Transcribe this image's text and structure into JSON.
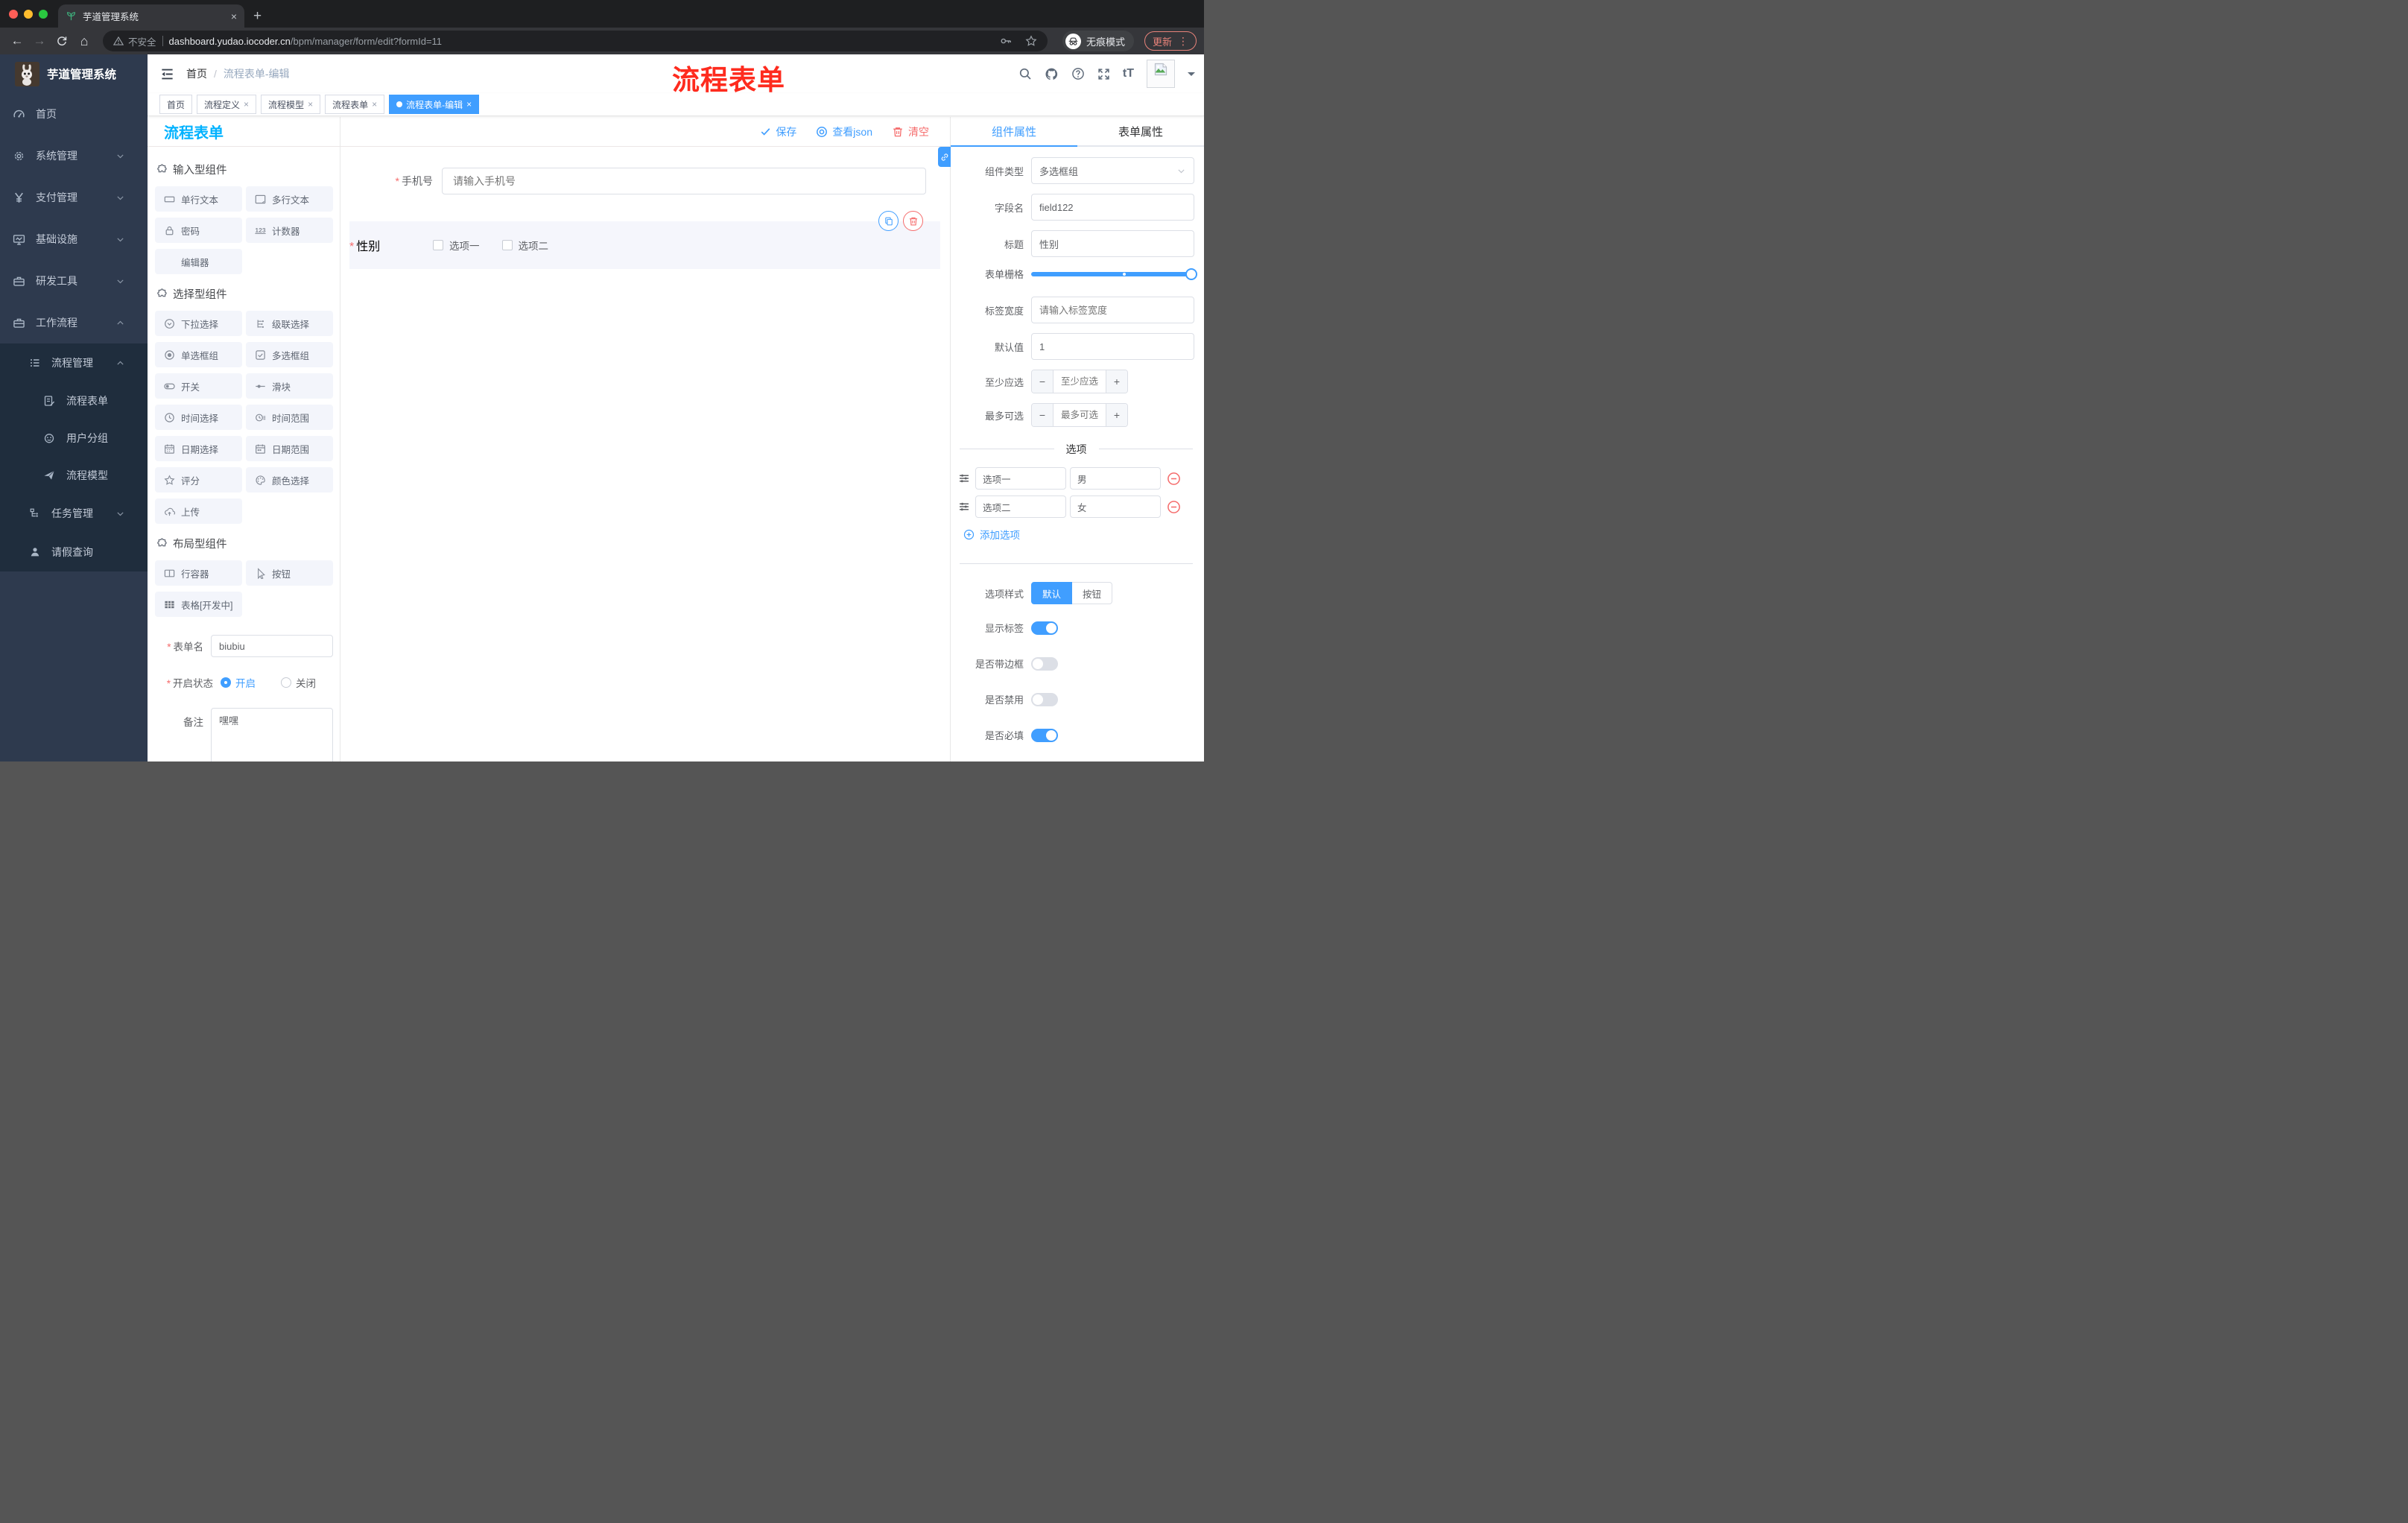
{
  "browser": {
    "tab_title": "芋道管理系统",
    "security": "不安全",
    "url_host": "dashboard.yudao.iocoder.cn",
    "url_path": "/bpm/manager/form/edit?formId=11",
    "incognito": "无痕模式",
    "update": "更新"
  },
  "sidebar": {
    "brand": "芋道管理系统",
    "home": "首页",
    "system": "系统管理",
    "pay": "支付管理",
    "infra": "基础设施",
    "dev": "研发工具",
    "workflow": "工作流程",
    "process_manage": "流程管理",
    "process_form": "流程表单",
    "user_group": "用户分组",
    "process_model": "流程模型",
    "task_manage": "任务管理",
    "leave_query": "请假查询"
  },
  "header": {
    "breadcrumb_home": "首页",
    "breadcrumb_sep": "/",
    "breadcrumb_current": "流程表单-编辑",
    "annotation": "流程表单"
  },
  "tags": {
    "home": "首页",
    "def": "流程定义",
    "model": "流程模型",
    "form": "流程表单",
    "edit": "流程表单-编辑"
  },
  "palette": {
    "title": "流程表单",
    "sec_input": "输入型组件",
    "single": "单行文本",
    "multi": "多行文本",
    "password": "密码",
    "counter": "计数器",
    "counter_glyph": "123",
    "editor": "编辑器",
    "sec_select": "选择型组件",
    "select": "下拉选择",
    "cascader": "级联选择",
    "radio": "单选框组",
    "checkbox": "多选框组",
    "switch": "开关",
    "slider": "滑块",
    "time": "时间选择",
    "time_range": "时间范围",
    "date": "日期选择",
    "date_range": "日期范围",
    "rate": "评分",
    "color": "颜色选择",
    "upload": "上传",
    "sec_layout": "布局型组件",
    "row": "行容器",
    "button": "按钮",
    "table": "表格[开发中]"
  },
  "meta": {
    "name_label": "表单名",
    "name_value": "biubiu",
    "status_label": "开启状态",
    "status_on": "开启",
    "status_off": "关闭",
    "remark_label": "备注",
    "remark_value": "嘿嘿"
  },
  "canvas": {
    "save": "保存",
    "view_json": "查看json",
    "clear": "清空",
    "phone_label": "手机号",
    "phone_placeholder": "请输入手机号",
    "gender_label": "性别",
    "opt1": "选项一",
    "opt2": "选项二"
  },
  "props": {
    "tab_component": "组件属性",
    "tab_form": "表单属性",
    "type_label": "组件类型",
    "type_value": "多选框组",
    "field_label": "字段名",
    "field_value": "field122",
    "title_label": "标题",
    "title_value": "性别",
    "grid_label": "表单栅格",
    "width_label": "标签宽度",
    "width_placeholder": "请输入标签宽度",
    "default_label": "默认值",
    "default_value": "1",
    "min_label": "至少应选",
    "min_placeholder": "至少应选",
    "max_label": "最多可选",
    "max_placeholder": "最多可选",
    "options_title": "选项",
    "opt1_label": "选项一",
    "opt1_value": "男",
    "opt2_label": "选项二",
    "opt2_value": "女",
    "add_option": "添加选项",
    "style_label": "选项样式",
    "style_default": "默认",
    "style_button": "按钮",
    "show_label_label": "显示标签",
    "border_label": "是否带边框",
    "disabled_label": "是否禁用",
    "required_label": "是否必填"
  },
  "glyphs": {
    "close": "×",
    "plus": "+",
    "back": "←",
    "forward": "→",
    "home": "⌂",
    "dots": "⋮",
    "tt": "tT",
    "question": "?",
    "minus": "−",
    "stepplus": "+"
  }
}
